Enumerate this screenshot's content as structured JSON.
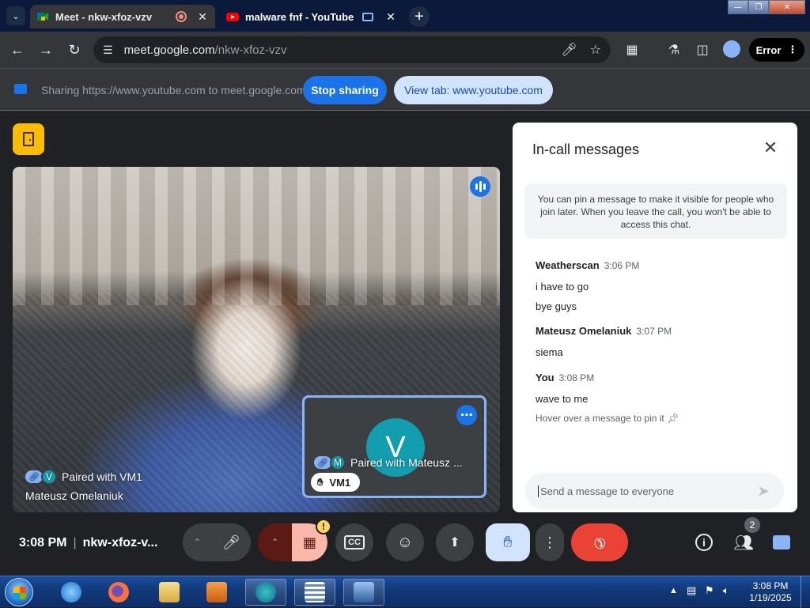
{
  "browser": {
    "tabs": [
      {
        "title": "Meet - nkw-xfoz-vzv"
      },
      {
        "title": "malware fnf - YouTube"
      }
    ],
    "url_host": "meet.google.com",
    "url_path": "/nkw-xfoz-vzv",
    "profile_chip": "Error"
  },
  "share_bar": {
    "text": "Sharing https://www.youtube.com to meet.google.com",
    "stop_label": "Stop sharing",
    "view_label": "View tab: www.youtube.com"
  },
  "stage": {
    "main_tile": {
      "paired_text": "Paired with VM1",
      "paired_initial": "V",
      "name": "Mateusz Omelaniuk"
    },
    "self_tile": {
      "avatar_letter": "V",
      "paired_text": "Paired with Mateusz ...",
      "paired_initial": "M",
      "name": "VM1"
    }
  },
  "chat": {
    "title": "In-call messages",
    "info": "You can pin a message to make it visible for people who join later. When you leave the call, you won't be able to access this chat.",
    "messages": [
      {
        "sender": "Weatherscan",
        "time": "3:06 PM",
        "lines": [
          "i have to go",
          "bye guys"
        ]
      },
      {
        "sender": "Mateusz Omelaniuk",
        "time": "3:07 PM",
        "lines": [
          "siema"
        ]
      },
      {
        "sender": "You",
        "time": "3:08 PM",
        "lines": [
          "wave to me"
        ],
        "hint": "Hover over a message to pin it"
      }
    ],
    "composer_placeholder": "Send a message to everyone"
  },
  "controls": {
    "time": "3:08 PM",
    "meeting_code": "nkw-xfoz-v...",
    "camera_warning": "!",
    "people_count": "2"
  },
  "taskbar": {
    "time": "3:08 PM",
    "date": "1/19/2025"
  }
}
